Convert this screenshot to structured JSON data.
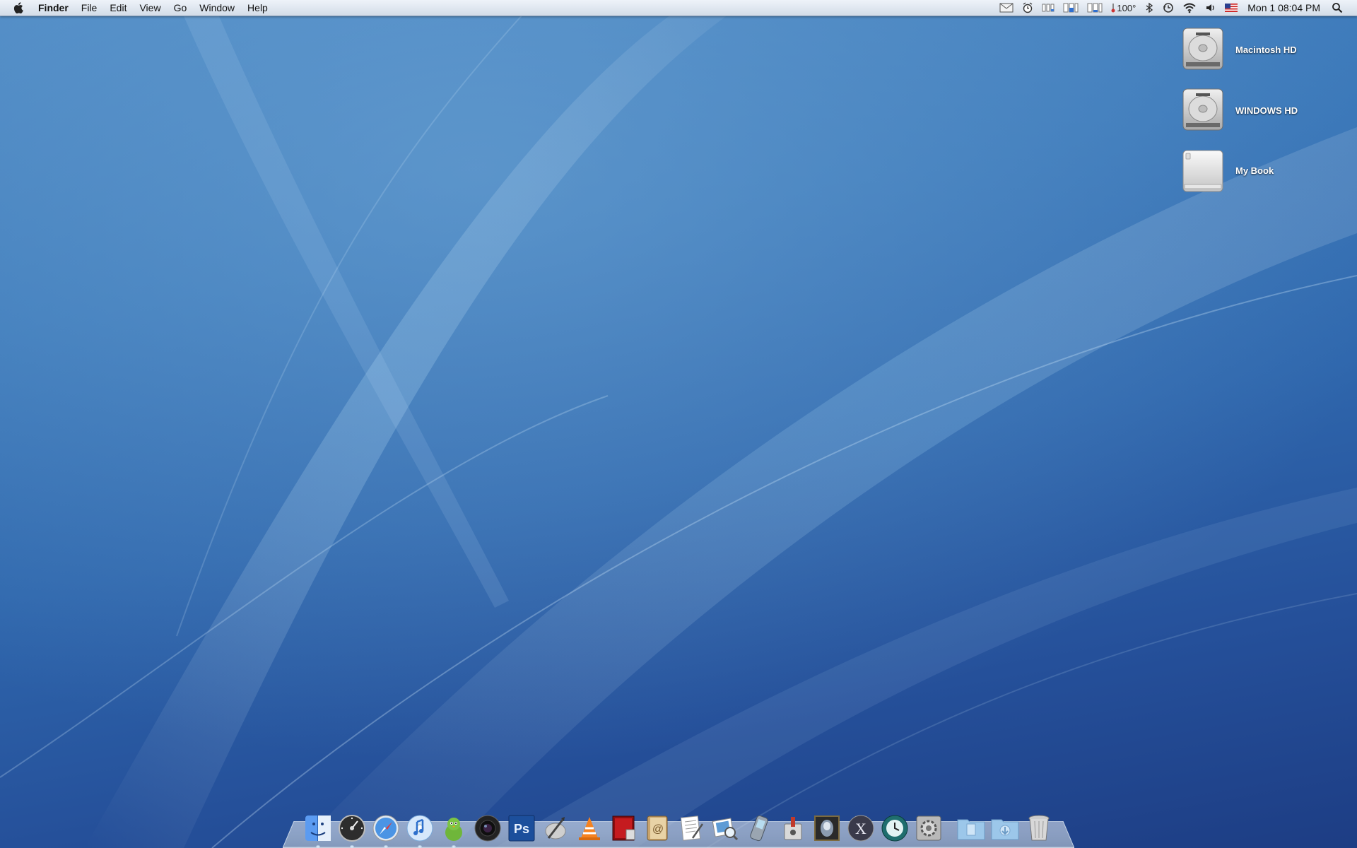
{
  "menubar": {
    "apple_icon": "apple-icon",
    "app_name": "Finder",
    "menus": [
      "File",
      "Edit",
      "View",
      "Go",
      "Window",
      "Help"
    ],
    "status": {
      "temperature": "100°",
      "clock": "Mon 1 08:04 PM",
      "icons": [
        "mail-icon",
        "alarm-clock-icon",
        "cpu-meter-icon",
        "disk-meter-icon",
        "network-meter-icon",
        "temperature-icon",
        "bluetooth-icon",
        "time-machine-icon",
        "wifi-icon",
        "volume-icon",
        "us-flag-icon",
        "spotlight-icon"
      ]
    }
  },
  "desktop_icons": [
    {
      "label": "Macintosh HD",
      "icon": "hard-drive-icon"
    },
    {
      "label": "WINDOWS HD",
      "icon": "hard-drive-icon"
    },
    {
      "label": "My Book",
      "icon": "external-drive-icon"
    }
  ],
  "dock": {
    "apps": [
      {
        "icon": "finder-icon",
        "running": true
      },
      {
        "icon": "dashboard-icon",
        "running": true
      },
      {
        "icon": "safari-icon",
        "running": true
      },
      {
        "icon": "itunes-icon",
        "running": true
      },
      {
        "icon": "adium-icon",
        "running": true
      },
      {
        "icon": "aperture-icon",
        "running": false
      },
      {
        "icon": "photoshop-icon",
        "running": false
      },
      {
        "icon": "script-editor-icon",
        "running": false
      },
      {
        "icon": "vlc-icon",
        "running": false
      },
      {
        "icon": "dvd-player-icon",
        "running": false
      },
      {
        "icon": "address-book-icon",
        "running": false
      },
      {
        "icon": "textedit-icon",
        "running": false
      },
      {
        "icon": "preview-icon",
        "running": false
      },
      {
        "icon": "iphone-config-icon",
        "running": false
      },
      {
        "icon": "utility-icon",
        "running": false
      },
      {
        "icon": "game-icon",
        "running": false
      },
      {
        "icon": "mac-os-x-icon",
        "running": false
      },
      {
        "icon": "time-machine-icon",
        "running": false
      },
      {
        "icon": "system-preferences-icon",
        "running": false
      }
    ],
    "stacks": [
      {
        "icon": "documents-folder-icon"
      },
      {
        "icon": "downloads-folder-icon"
      },
      {
        "icon": "trash-icon"
      }
    ]
  },
  "colors": {
    "wallpaper_top": "#4a86c2",
    "wallpaper_bottom": "#1d3d84",
    "menubar": "#dfe6ef"
  }
}
